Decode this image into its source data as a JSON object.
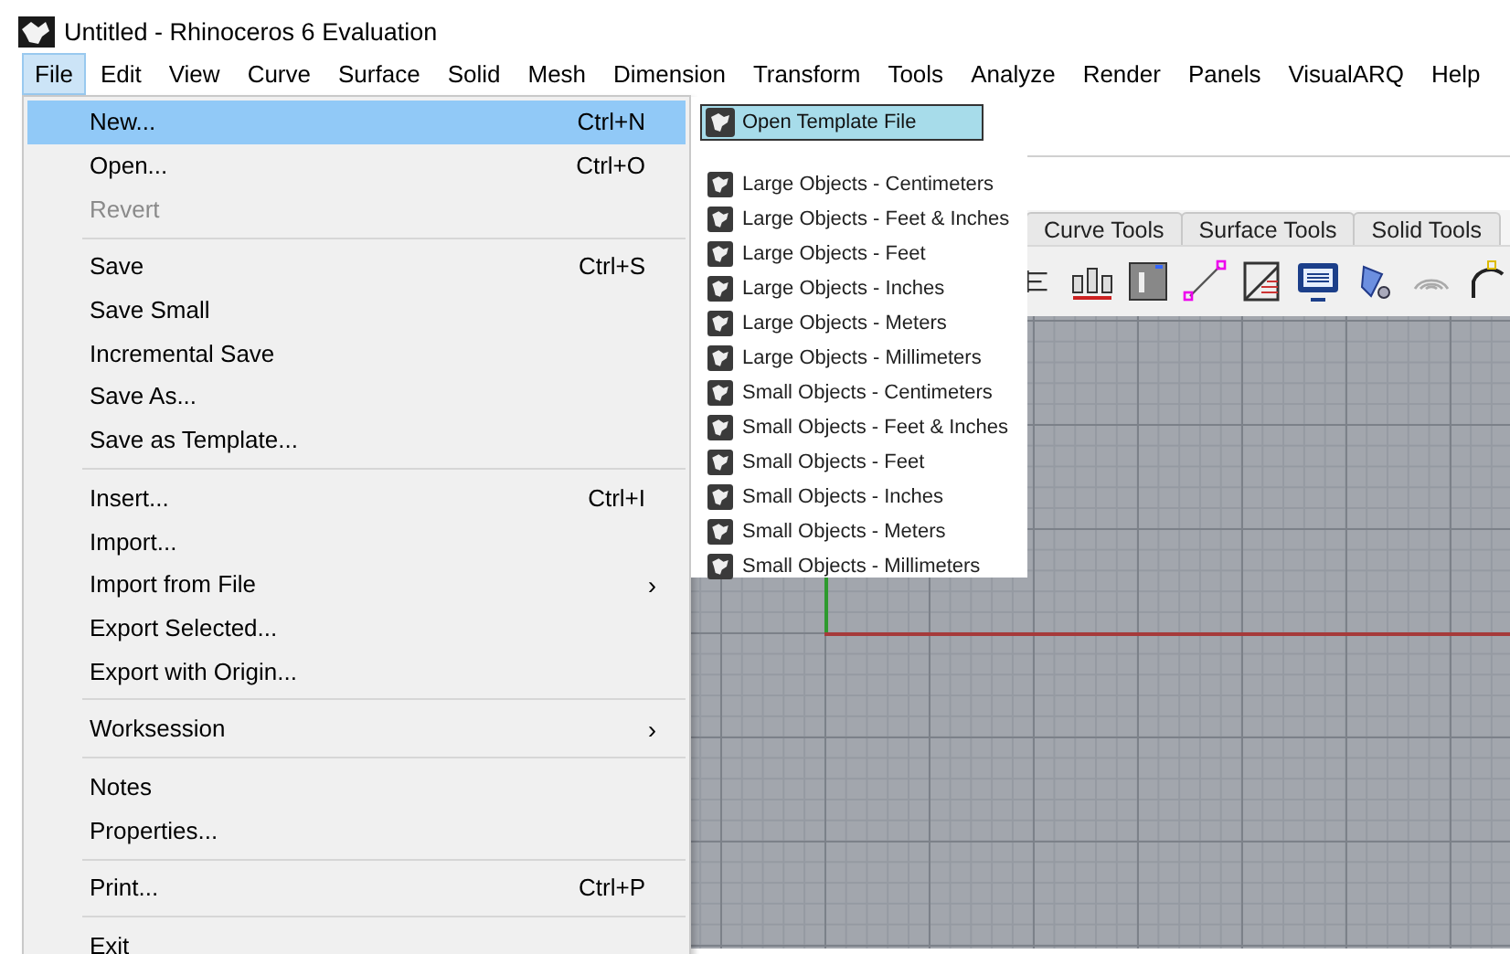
{
  "window": {
    "title": "Untitled - Rhinoceros 6 Evaluation"
  },
  "menu_bar": [
    {
      "label": "File",
      "selected": true
    },
    {
      "label": "Edit",
      "selected": false
    },
    {
      "label": "View",
      "selected": false
    },
    {
      "label": "Curve",
      "selected": false
    },
    {
      "label": "Surface",
      "selected": false
    },
    {
      "label": "Solid",
      "selected": false
    },
    {
      "label": "Mesh",
      "selected": false
    },
    {
      "label": "Dimension",
      "selected": false
    },
    {
      "label": "Transform",
      "selected": false
    },
    {
      "label": "Tools",
      "selected": false
    },
    {
      "label": "Analyze",
      "selected": false
    },
    {
      "label": "Render",
      "selected": false
    },
    {
      "label": "Panels",
      "selected": false
    },
    {
      "label": "VisualARQ",
      "selected": false
    },
    {
      "label": "Help",
      "selected": false
    }
  ],
  "file_menu": [
    {
      "kind": "item",
      "label": "New...",
      "shortcut": "Ctrl+N",
      "selected": true,
      "disabled": false
    },
    {
      "kind": "item",
      "label": "Open...",
      "shortcut": "Ctrl+O",
      "selected": false,
      "disabled": false
    },
    {
      "kind": "item",
      "label": "Revert",
      "selected": false,
      "disabled": true
    },
    {
      "kind": "separator"
    },
    {
      "kind": "item",
      "label": "Save",
      "shortcut": "Ctrl+S",
      "selected": false,
      "disabled": false
    },
    {
      "kind": "item",
      "label": "Save Small",
      "selected": false,
      "disabled": false
    },
    {
      "kind": "item",
      "label": "Incremental Save",
      "selected": false,
      "disabled": false
    },
    {
      "kind": "item",
      "label": "Save As...",
      "selected": false,
      "disabled": false
    },
    {
      "kind": "item",
      "label": "Save as Template...",
      "selected": false,
      "disabled": false
    },
    {
      "kind": "separator"
    },
    {
      "kind": "item",
      "label": "Insert...",
      "shortcut": "Ctrl+I",
      "selected": false,
      "disabled": false
    },
    {
      "kind": "item",
      "label": "Import...",
      "selected": false,
      "disabled": false
    },
    {
      "kind": "item",
      "label": "Import from File",
      "arrow": "›",
      "selected": false,
      "disabled": false
    },
    {
      "kind": "item",
      "label": "Export Selected...",
      "selected": false,
      "disabled": false
    },
    {
      "kind": "item",
      "label": "Export with Origin...",
      "selected": false,
      "disabled": false
    },
    {
      "kind": "separator"
    },
    {
      "kind": "item",
      "label": "Worksession",
      "arrow": "›",
      "selected": false,
      "disabled": false
    },
    {
      "kind": "separator"
    },
    {
      "kind": "item",
      "label": "Notes",
      "selected": false,
      "disabled": false
    },
    {
      "kind": "item",
      "label": "Properties...",
      "selected": false,
      "disabled": false
    },
    {
      "kind": "separator"
    },
    {
      "kind": "item",
      "label": "Print...",
      "shortcut": "Ctrl+P",
      "selected": false,
      "disabled": false
    },
    {
      "kind": "separator"
    },
    {
      "kind": "item",
      "label": "Exit",
      "selected": false,
      "disabled": false
    }
  ],
  "new_submenu": {
    "header": "Open Template File",
    "templates": [
      "Large Objects - Centimeters",
      "Large Objects - Feet & Inches",
      "Large Objects - Feet",
      "Large Objects - Inches",
      "Large Objects - Meters",
      "Large Objects - Millimeters",
      "Small Objects - Centimeters",
      "Small Objects - Feet & Inches",
      "Small Objects - Feet",
      "Small Objects - Inches",
      "Small Objects - Meters",
      "Small Objects - Millimeters"
    ]
  },
  "toolbar_tabs": [
    {
      "label": "Curve Tools",
      "selected": false
    },
    {
      "label": "Surface Tools",
      "selected": false
    },
    {
      "label": "Solid Tools",
      "selected": false
    }
  ]
}
